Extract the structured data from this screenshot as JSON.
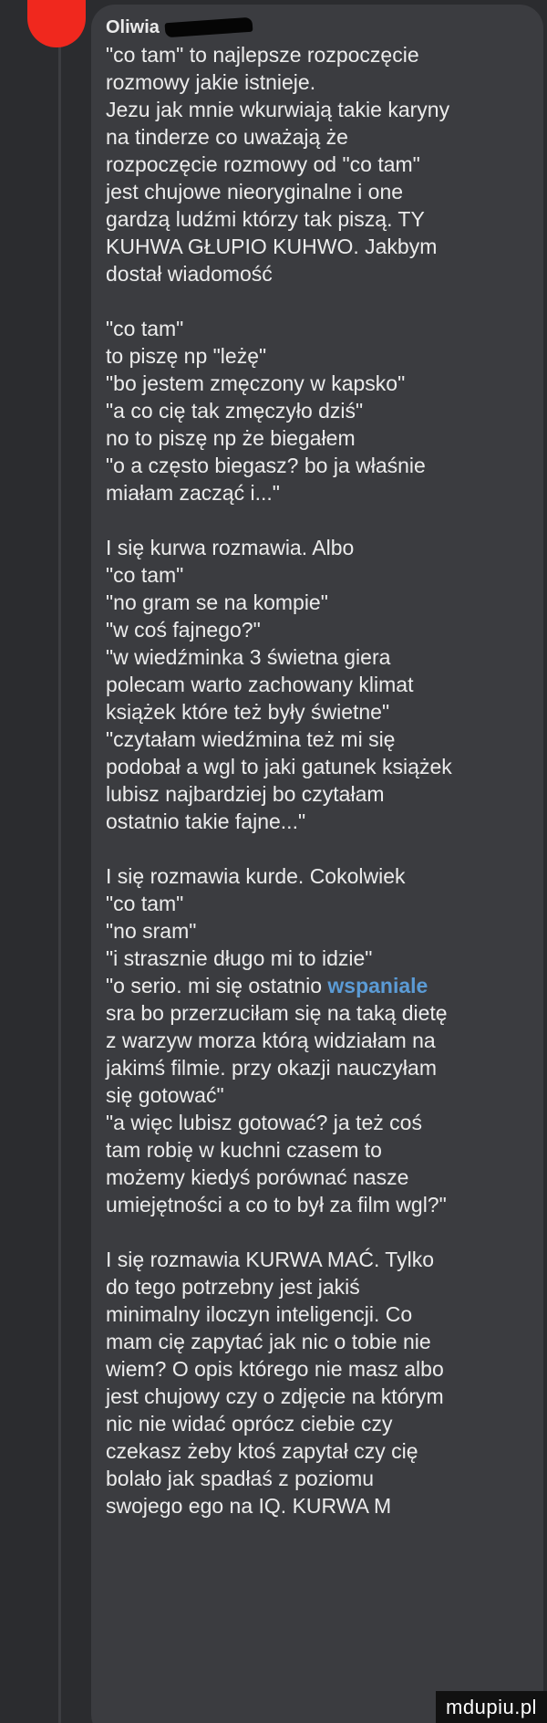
{
  "comment": {
    "author": "Oliwia",
    "paragraphs": [
      [
        "\"co tam\" to najlepsze rozpoczęcie",
        "rozmowy jakie istnieje.",
        "Jezu jak mnie wkurwiają takie karyny",
        "na tinderze co uważają że",
        "rozpoczęcie rozmowy od \"co tam\"",
        "jest chujowe nieoryginalne i one",
        "gardzą ludźmi którzy tak piszą. TY",
        "KUHWA GŁUPIO KUHWO. Jakbym",
        "dostał wiadomość"
      ],
      [
        "\"co tam\"",
        "to piszę np \"leżę\"",
        "\"bo jestem zmęczony w kapsko\"",
        "\"a co cię tak zmęczyło dziś\"",
        "no to piszę np że biegałem",
        "\"o a często biegasz? bo ja właśnie",
        "miałam zacząć i...\""
      ],
      [
        "I się kurwa rozmawia. Albo",
        "\"co tam\"",
        "\"no gram se na kompie\"",
        "\"w coś fajnego?\"",
        "\"w wiedźminka 3 świetna giera",
        "polecam warto zachowany klimat",
        "książek które też były świetne\"",
        "\"czytałam wiedźmina też mi się",
        "podobał a wgl to jaki gatunek książek",
        "lubisz najbardziej bo czytałam",
        "ostatnio takie fajne...\""
      ],
      [
        "I się rozmawia kurde. Cokolwiek",
        "\"co tam\"",
        "\"no sram\"",
        "\"i strasznie długo mi to idzie\"",
        "\"o serio. mi się ostatnio ",
        "sra bo przerzuciłam się na taką dietę",
        "z warzyw morza którą widziałam na",
        "jakimś filmie. przy okazji nauczyłam",
        "się gotować\"",
        "\"a więc lubisz gotować? ja też coś",
        "tam robię w kuchni czasem to",
        "możemy kiedyś porównać nasze",
        "umiejętności a co to był za film wgl?\""
      ],
      [
        "I się rozmawia KURWA MAĆ. Tylko",
        "do tego potrzebny jest jakiś",
        "minimalny iloczyn inteligencji. Co",
        "mam cię zapytać jak nic o tobie nie",
        "wiem? O opis którego nie masz albo",
        "jest chujowy czy o zdjęcie na którym",
        "nic nie widać oprócz ciebie czy",
        "czekasz żeby ktoś zapytał czy cię",
        "bolało jak spadłaś z poziomu",
        "swojego ego na IQ. KURWA M"
      ]
    ],
    "link_word": "wspaniale"
  },
  "watermark": "mdupiu.pl",
  "colors": {
    "background": "#2b2c2f",
    "bubble": "#3b3c40",
    "text": "#ececec",
    "link": "#5b9bd5",
    "avatar": "#f0281e"
  }
}
